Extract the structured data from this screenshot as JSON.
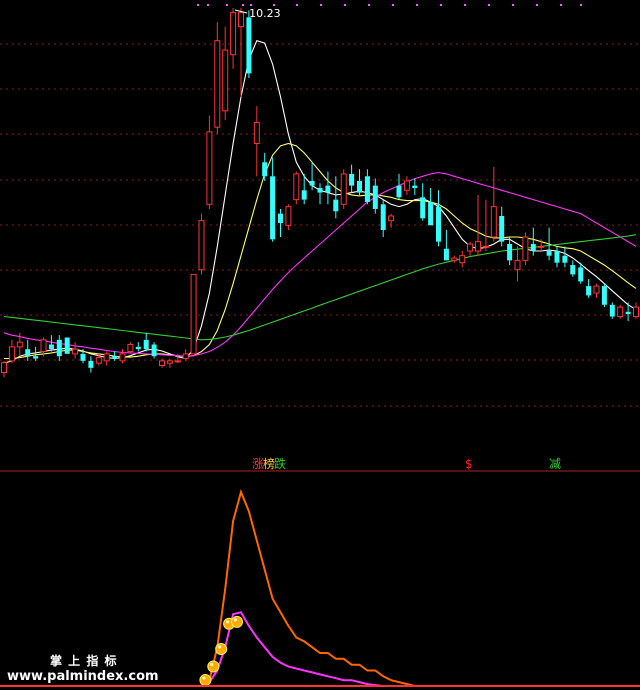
{
  "chart_data": [
    {
      "type": "candlestick",
      "name": "",
      "y_range": [
        1.0,
        10.5
      ],
      "peak_label": "10.23",
      "candles": [
        [
          2.7,
          2.91,
          2.6,
          2.95
        ],
        [
          2.95,
          3.25,
          2.9,
          3.4
        ],
        [
          3.25,
          3.35,
          3.05,
          3.55
        ],
        [
          3.2,
          3.05,
          2.95,
          3.4
        ],
        [
          3.05,
          3.0,
          2.95,
          3.25
        ],
        [
          3.15,
          3.4,
          3.05,
          3.45
        ],
        [
          3.3,
          3.2,
          3.15,
          3.5
        ],
        [
          3.4,
          3.05,
          2.95,
          3.5
        ],
        [
          3.45,
          3.1,
          3.1,
          3.45
        ],
        [
          3.1,
          3.2,
          3.0,
          3.35
        ],
        [
          3.1,
          2.95,
          2.9,
          3.2
        ],
        [
          2.95,
          2.8,
          2.7,
          3.05
        ],
        [
          2.9,
          3.02,
          2.85,
          3.1
        ],
        [
          2.95,
          3.1,
          2.85,
          3.15
        ],
        [
          3.05,
          3.0,
          2.95,
          3.15
        ],
        [
          2.95,
          3.1,
          2.9,
          3.2
        ],
        [
          3.15,
          3.3,
          3.1,
          3.35
        ],
        [
          3.25,
          3.2,
          3.15,
          3.35
        ],
        [
          3.4,
          3.2,
          3.15,
          3.55
        ],
        [
          3.3,
          3.05,
          3.0,
          3.35
        ],
        [
          2.85,
          2.95,
          2.8,
          3.0
        ],
        [
          2.9,
          2.95,
          2.8,
          3.0
        ],
        [
          2.95,
          2.95,
          2.9,
          3.1
        ],
        [
          3.0,
          3.1,
          2.95,
          3.2
        ],
        [
          3.1,
          4.8,
          3.1,
          4.8
        ],
        [
          4.9,
          5.95,
          4.8,
          6.1
        ],
        [
          6.3,
          7.85,
          6.2,
          8.2
        ],
        [
          7.95,
          9.8,
          7.8,
          10.2
        ],
        [
          8.3,
          9.6,
          8.1,
          10.1
        ],
        [
          9.5,
          10.4,
          9.2,
          10.5
        ],
        [
          10.1,
          10.4,
          8.6,
          10.5
        ],
        [
          10.3,
          9.1,
          9.0,
          10.45
        ],
        [
          7.6,
          8.05,
          6.9,
          8.4
        ],
        [
          7.2,
          6.9,
          6.8,
          7.4
        ],
        [
          6.9,
          5.55,
          5.5,
          7.3
        ],
        [
          6.1,
          5.9,
          5.6,
          6.2
        ],
        [
          5.85,
          6.25,
          5.75,
          6.3
        ],
        [
          6.4,
          6.95,
          6.3,
          7.0
        ],
        [
          6.6,
          6.4,
          6.3,
          6.95
        ],
        [
          6.8,
          6.7,
          6.6,
          7.2
        ],
        [
          6.65,
          6.55,
          6.3,
          6.75
        ],
        [
          6.7,
          6.55,
          6.3,
          7.0
        ],
        [
          6.4,
          6.15,
          6.0,
          6.9
        ],
        [
          6.3,
          6.95,
          6.2,
          7.05
        ],
        [
          6.95,
          6.7,
          6.55,
          7.15
        ],
        [
          6.8,
          6.55,
          6.5,
          7.05
        ],
        [
          6.9,
          6.35,
          6.3,
          7.05
        ],
        [
          6.7,
          6.2,
          6.1,
          6.85
        ],
        [
          6.3,
          5.75,
          5.6,
          6.4
        ],
        [
          5.95,
          6.05,
          5.8,
          6.1
        ],
        [
          6.7,
          6.45,
          6.4,
          6.95
        ],
        [
          6.6,
          6.8,
          6.5,
          6.9
        ],
        [
          6.7,
          6.65,
          6.5,
          6.85
        ],
        [
          6.45,
          6.0,
          5.95,
          6.75
        ],
        [
          6.35,
          5.85,
          5.85,
          6.65
        ],
        [
          6.25,
          5.5,
          5.4,
          6.6
        ],
        [
          5.35,
          5.1,
          5.1,
          5.75
        ],
        [
          5.1,
          5.15,
          5.05,
          5.2
        ],
        [
          5.05,
          5.2,
          4.95,
          5.3
        ],
        [
          5.3,
          5.45,
          5.2,
          5.5
        ],
        [
          5.3,
          5.5,
          5.2,
          6.5
        ],
        [
          5.4,
          5.4,
          5.3,
          6.4
        ],
        [
          5.6,
          6.25,
          5.5,
          7.1
        ],
        [
          6.05,
          5.5,
          5.4,
          6.25
        ],
        [
          5.45,
          5.1,
          5.0,
          5.6
        ],
        [
          4.9,
          5.1,
          4.65,
          5.4
        ],
        [
          5.1,
          5.6,
          5.0,
          5.7
        ],
        [
          5.45,
          5.3,
          5.2,
          5.8
        ],
        [
          5.4,
          5.4,
          5.3,
          5.55
        ],
        [
          5.3,
          5.2,
          5.1,
          5.8
        ],
        [
          5.3,
          5.05,
          4.95,
          5.4
        ],
        [
          5.2,
          5.05,
          4.95,
          5.4
        ],
        [
          5.0,
          4.8,
          4.75,
          5.1
        ],
        [
          4.95,
          4.65,
          4.6,
          5.05
        ],
        [
          4.55,
          4.35,
          4.3,
          4.7
        ],
        [
          4.4,
          4.55,
          4.3,
          4.6
        ],
        [
          4.55,
          4.15,
          4.1,
          4.6
        ],
        [
          4.15,
          3.9,
          3.85,
          4.2
        ],
        [
          3.9,
          4.1,
          3.85,
          4.15
        ],
        [
          4.0,
          3.95,
          3.8,
          4.2
        ],
        [
          3.9,
          4.1,
          3.85,
          4.2
        ]
      ],
      "ma_lines": [
        {
          "color": "#ffffff",
          "values": [
            2.9,
            2.95,
            3.05,
            3.1,
            3.12,
            3.15,
            3.18,
            3.2,
            3.22,
            3.2,
            3.16,
            3.1,
            3.06,
            3.02,
            3,
            3.02,
            3.06,
            3.12,
            3.18,
            3.2,
            3.16,
            3.1,
            3.04,
            3,
            3.2,
            3.7,
            4.4,
            5.4,
            6.5,
            7.6,
            8.6,
            9.4,
            9.8,
            9.75,
            9.3,
            8.6,
            7.8,
            7.2,
            6.9,
            6.7,
            6.6,
            6.55,
            6.5,
            6.52,
            6.55,
            6.58,
            6.55,
            6.5,
            6.4,
            6.3,
            6.25,
            6.3,
            6.4,
            6.42,
            6.35,
            6.25,
            6.05,
            5.8,
            5.55,
            5.4,
            5.35,
            5.38,
            5.45,
            5.55,
            5.55,
            5.45,
            5.35,
            5.3,
            5.3,
            5.32,
            5.3,
            5.25,
            5.15,
            5.02,
            4.88,
            4.75,
            4.6,
            4.45,
            4.3,
            4.15,
            4.05
          ]
        },
        {
          "color": "#ffff66",
          "values": [
            3.0,
            3.0,
            3.02,
            3.05,
            3.08,
            3.1,
            3.12,
            3.15,
            3.18,
            3.18,
            3.15,
            3.12,
            3.1,
            3.08,
            3.05,
            3.03,
            3.03,
            3.05,
            3.08,
            3.1,
            3.1,
            3.08,
            3.06,
            3.04,
            3.06,
            3.15,
            3.3,
            3.6,
            4.05,
            4.6,
            5.2,
            5.8,
            6.4,
            6.95,
            7.35,
            7.55,
            7.6,
            7.55,
            7.4,
            7.2,
            7.0,
            6.8,
            6.65,
            6.55,
            6.5,
            6.48,
            6.5,
            6.5,
            6.48,
            6.45,
            6.4,
            6.38,
            6.38,
            6.38,
            6.35,
            6.3,
            6.2,
            6.05,
            5.9,
            5.78,
            5.7,
            5.62,
            5.58,
            5.58,
            5.6,
            5.6,
            5.58,
            5.55,
            5.5,
            5.45,
            5.4,
            5.37,
            5.35,
            5.3,
            5.2,
            5.1,
            5.0,
            4.88,
            4.75,
            4.62,
            4.5
          ]
        },
        {
          "color": "#ff33ff",
          "values": [
            3.55,
            3.5,
            3.47,
            3.43,
            3.4,
            3.38,
            3.35,
            3.32,
            3.3,
            3.27,
            3.25,
            3.22,
            3.2,
            3.17,
            3.15,
            3.13,
            3.12,
            3.11,
            3.1,
            3.09,
            3.08,
            3.07,
            3.06,
            3.05,
            3.06,
            3.1,
            3.15,
            3.24,
            3.35,
            3.5,
            3.68,
            3.88,
            4.08,
            4.28,
            4.48,
            4.66,
            4.84,
            5.0,
            5.15,
            5.3,
            5.45,
            5.6,
            5.75,
            5.9,
            6.05,
            6.2,
            6.35,
            6.45,
            6.55,
            6.63,
            6.7,
            6.78,
            6.85,
            6.9,
            6.95,
            6.98,
            6.95,
            6.9,
            6.85,
            6.8,
            6.75,
            6.7,
            6.65,
            6.6,
            6.55,
            6.5,
            6.45,
            6.4,
            6.35,
            6.3,
            6.25,
            6.2,
            6.15,
            6.1,
            6.0,
            5.9,
            5.8,
            5.7,
            5.6,
            5.5,
            5.4
          ]
        },
        {
          "color": "#33cc33",
          "values": [
            3.9,
            3.88,
            3.86,
            3.84,
            3.82,
            3.8,
            3.78,
            3.76,
            3.74,
            3.72,
            3.7,
            3.68,
            3.66,
            3.64,
            3.62,
            3.6,
            3.58,
            3.56,
            3.54,
            3.52,
            3.5,
            3.48,
            3.46,
            3.44,
            3.42,
            3.4,
            3.41,
            3.43,
            3.46,
            3.5,
            3.55,
            3.6,
            3.66,
            3.72,
            3.78,
            3.84,
            3.9,
            3.96,
            4.02,
            4.08,
            4.14,
            4.2,
            4.26,
            4.32,
            4.38,
            4.44,
            4.5,
            4.56,
            4.62,
            4.68,
            4.74,
            4.8,
            4.86,
            4.92,
            4.97,
            5.02,
            5.06,
            5.1,
            5.14,
            5.18,
            5.21,
            5.24,
            5.27,
            5.3,
            5.32,
            5.34,
            5.36,
            5.38,
            5.4,
            5.42,
            5.44,
            5.46,
            5.48,
            5.5,
            5.52,
            5.54,
            5.56,
            5.58,
            5.6,
            5.62,
            5.65
          ]
        }
      ]
    },
    {
      "type": "line",
      "name": "",
      "labels": [
        {
          "text": "涨",
          "color": "#ff3333"
        },
        {
          "text": "榜",
          "color": "#ffcc33"
        },
        {
          "text": "跌",
          "color": "#33cc33"
        },
        {
          "text": "$",
          "color": "#ff2222"
        },
        {
          "text": "减",
          "color": "#33cc33"
        }
      ],
      "series": [
        {
          "color": "#ff6600",
          "points": [
            [
              0,
              0
            ],
            [
              25,
              0
            ],
            [
              26,
              0.03
            ],
            [
              27,
              0.2
            ],
            [
              28,
              0.5
            ],
            [
              29,
              0.85
            ],
            [
              30,
              1.0
            ],
            [
              31,
              0.9
            ],
            [
              32,
              0.75
            ],
            [
              33,
              0.6
            ],
            [
              34,
              0.45
            ],
            [
              35,
              0.38
            ],
            [
              36,
              0.31
            ],
            [
              37,
              0.25
            ],
            [
              38,
              0.23
            ],
            [
              39,
              0.2
            ],
            [
              40,
              0.17
            ],
            [
              41,
              0.17
            ],
            [
              42,
              0.14
            ],
            [
              43,
              0.14
            ],
            [
              44,
              0.11
            ],
            [
              45,
              0.11
            ],
            [
              46,
              0.08
            ],
            [
              47,
              0.08
            ],
            [
              48,
              0.05
            ],
            [
              49,
              0.03
            ],
            [
              50,
              0.02
            ],
            [
              52,
              0
            ],
            [
              80,
              0
            ]
          ]
        },
        {
          "color": "#ff33ff",
          "points": [
            [
              0,
              0
            ],
            [
              25,
              0
            ],
            [
              26,
              0.02
            ],
            [
              27,
              0.08
            ],
            [
              28,
              0.2
            ],
            [
              29,
              0.37
            ],
            [
              30,
              0.38
            ],
            [
              31,
              0.31
            ],
            [
              32,
              0.25
            ],
            [
              33,
              0.2
            ],
            [
              34,
              0.15
            ],
            [
              35,
              0.12
            ],
            [
              36,
              0.1
            ],
            [
              37,
              0.09
            ],
            [
              38,
              0.08
            ],
            [
              39,
              0.07
            ],
            [
              40,
              0.06
            ],
            [
              41,
              0.05
            ],
            [
              42,
              0.04
            ],
            [
              43,
              0.03
            ],
            [
              44,
              0.03
            ],
            [
              45,
              0.02
            ],
            [
              46,
              0.01
            ],
            [
              48,
              0
            ],
            [
              80,
              0
            ]
          ]
        }
      ],
      "markers": [
        {
          "x": 26,
          "y": 0.01
        },
        {
          "x": 27,
          "y": 0.08
        },
        {
          "x": 28,
          "y": 0.17
        },
        {
          "x": 29,
          "y": 0.3
        },
        {
          "x": 30,
          "y": 0.31
        }
      ]
    }
  ],
  "watermark": {
    "line1": "掌 上 指 标",
    "line2": "www.palmindex.com"
  }
}
